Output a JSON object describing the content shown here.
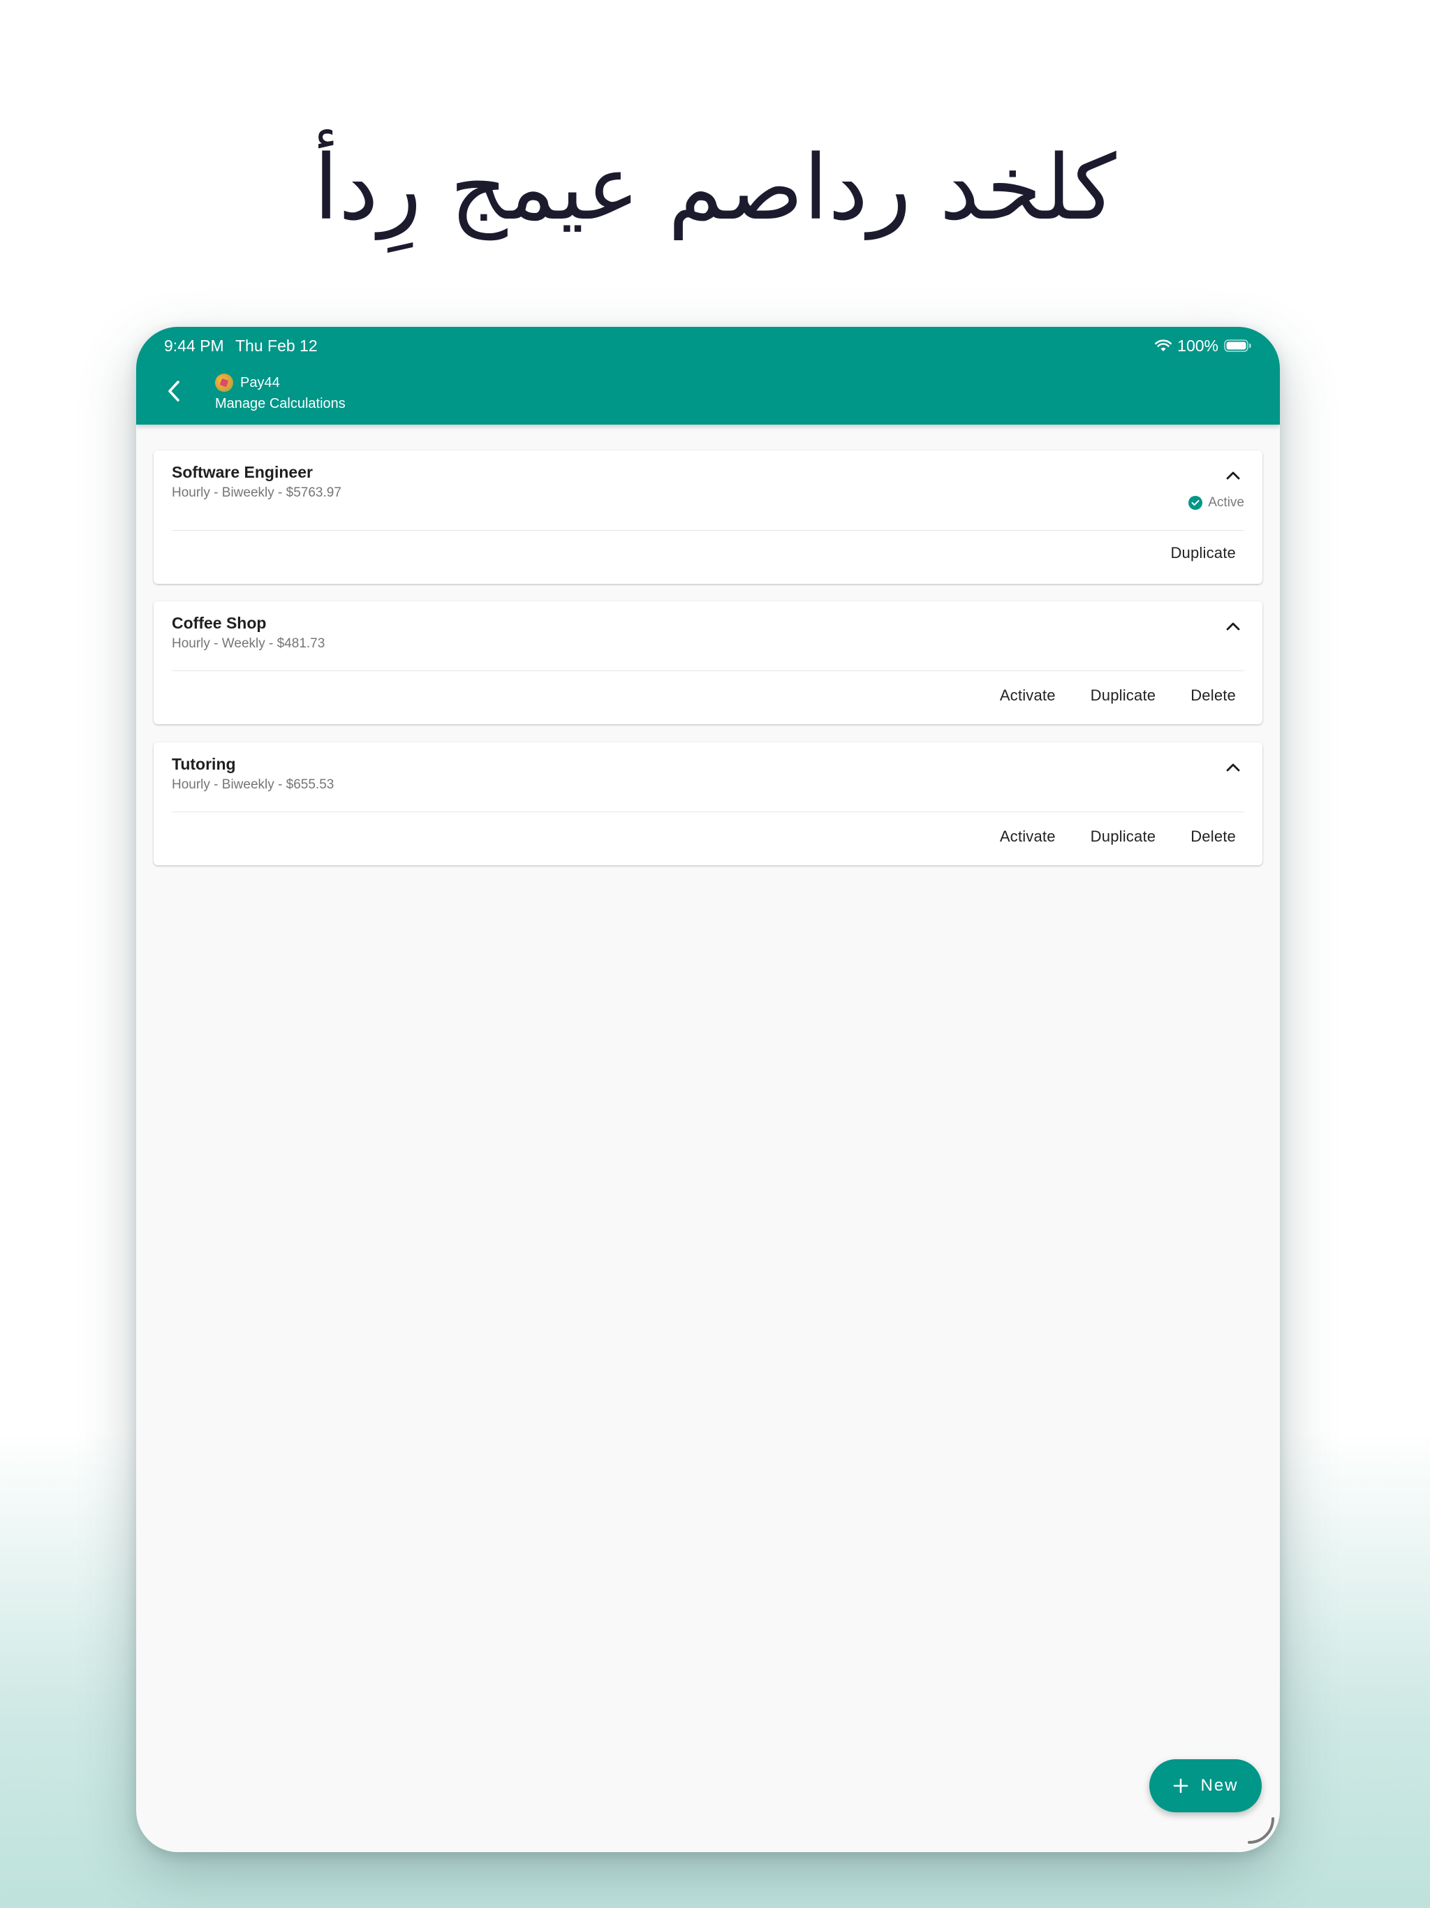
{
  "headline": "كلخد رداصم عيمج رِدأ",
  "status_bar": {
    "time": "9:44 PM",
    "date": "Thu Feb 12",
    "battery": "100%"
  },
  "app_bar": {
    "app_name": "Pay44",
    "subtitle": "Manage Calculations"
  },
  "calculations": [
    {
      "title": "Software Engineer",
      "subtitle": "Hourly - Biweekly - $5763.97",
      "status": "Active",
      "actions": [
        "Duplicate"
      ]
    },
    {
      "title": "Coffee Shop",
      "subtitle": "Hourly - Weekly - $481.73",
      "actions": [
        "Activate",
        "Duplicate",
        "Delete"
      ]
    },
    {
      "title": "Tutoring",
      "subtitle": "Hourly - Biweekly - $655.53",
      "actions": [
        "Activate",
        "Duplicate",
        "Delete"
      ]
    }
  ],
  "fab": {
    "label": "New",
    "icon": "plus-icon"
  },
  "colors": {
    "accent": "#009688",
    "background": "#f9f9f9",
    "headline": "#1c1b2e"
  }
}
